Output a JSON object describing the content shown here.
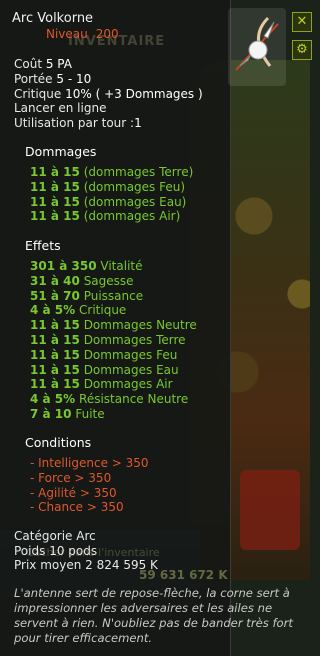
{
  "item": {
    "name": "Arc Volkorne",
    "level_label": "Niveau",
    "level_value": "200"
  },
  "background": {
    "inventory_label": "INVENTAIRE",
    "bottom_label": "Cacher dans l'inventaire",
    "kamas": "59 631 672 K"
  },
  "stats": [
    {
      "label": "Coût",
      "value": "5 PA"
    },
    {
      "label": "Portée",
      "value": "5 - 10"
    },
    {
      "label": "Critique",
      "value": "10% ( +3 Dommages )"
    },
    {
      "label": "Lancer en ligne",
      "value": ""
    },
    {
      "label": "Utilisation par tour :",
      "value": "1"
    }
  ],
  "damages": {
    "title": "Dommages",
    "lines": [
      {
        "range": "11 à 15",
        "text": "(dommages Terre)"
      },
      {
        "range": "11 à 15",
        "text": "(dommages Feu)"
      },
      {
        "range": "11 à 15",
        "text": "(dommages Eau)"
      },
      {
        "range": "11 à 15",
        "text": "(dommages Air)"
      }
    ]
  },
  "effects": {
    "title": "Effets",
    "lines": [
      {
        "range": "301 à 350",
        "text": "Vitalité"
      },
      {
        "range": "31 à 40",
        "text": "Sagesse"
      },
      {
        "range": "51 à 70",
        "text": "Puissance"
      },
      {
        "range": "4 à 5%",
        "text": "Critique"
      },
      {
        "range": "11 à 15",
        "text": "Dommages Neutre"
      },
      {
        "range": "11 à 15",
        "text": "Dommages Terre"
      },
      {
        "range": "11 à 15",
        "text": "Dommages Feu"
      },
      {
        "range": "11 à 15",
        "text": "Dommages Eau"
      },
      {
        "range": "11 à 15",
        "text": "Dommages Air"
      },
      {
        "range": "4 à 5%",
        "text": "Résistance Neutre"
      },
      {
        "range": "7 à 10",
        "text": "Fuite"
      }
    ]
  },
  "conditions": {
    "title": "Conditions",
    "lines": [
      "- Intelligence > 350",
      "- Force > 350",
      "- Agilité > 350",
      "- Chance > 350"
    ]
  },
  "meta": [
    {
      "label": "Catégorie",
      "value": "Arc"
    },
    {
      "label": "Poids",
      "value": "10 pods"
    },
    {
      "label": "Prix moyen",
      "value": "2 824 595 K"
    }
  ],
  "description": "L'antenne sert de repose-flèche, la corne sert à impressionner les adversaires et les ailes ne servent à rien. N'oubliez pas de bander très fort pour tirer efficacement.",
  "buttons": {
    "close": "✕",
    "settings": "⚙"
  },
  "colors": {
    "accent_green": "#79c82e",
    "requirement_red": "#e0572e",
    "button_border": "#8aa51c"
  }
}
